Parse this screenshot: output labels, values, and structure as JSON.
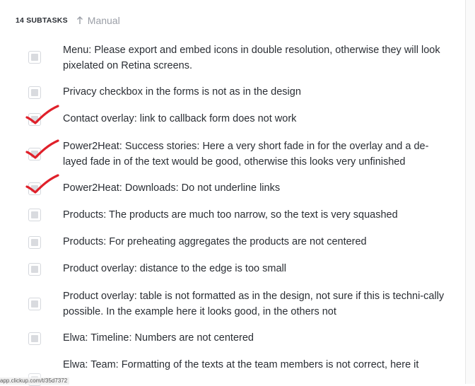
{
  "header": {
    "subtask_count": "14 SUBTASKS",
    "sort_label": "Manual",
    "sort_icon": "arrow-up-icon"
  },
  "subtasks": [
    {
      "text": "Menu: Please export and embed icons in double resolution, otherwise they will look pixelated on Retina screens.",
      "checked": false,
      "red_checkmark": false
    },
    {
      "text": "Privacy checkbox in the forms is not as in the design",
      "checked": false,
      "red_checkmark": false
    },
    {
      "text": "Contact overlay: link to callback form does not work",
      "checked": false,
      "red_checkmark": true
    },
    {
      "text": "Power2Heat: Success stories: Here a very short fade in for the overlay and a de-layed fade in of the text would be good, otherwise this looks very unfinished",
      "checked": false,
      "red_checkmark": true
    },
    {
      "text": "Power2Heat: Downloads: Do not underline links",
      "checked": false,
      "red_checkmark": true
    },
    {
      "text": "Products: The products are much too narrow, so the text is very squashed",
      "checked": false,
      "red_checkmark": false
    },
    {
      "text": "Products: For preheating aggregates the products are not centered",
      "checked": false,
      "red_checkmark": false
    },
    {
      "text": "Product overlay: distance to the edge is too small",
      "checked": false,
      "red_checkmark": false
    },
    {
      "text": "Product overlay: table is not formatted as in the design, not sure if this is techni-cally possible. In the example here it looks good, in the others not",
      "checked": false,
      "red_checkmark": false
    },
    {
      "text": "Elwa: Timeline: Numbers are not centered",
      "checked": false,
      "red_checkmark": false
    },
    {
      "text": "Elwa: Team: Formatting of the texts at the team members is not correct, here it",
      "checked": false,
      "red_checkmark": false
    }
  ],
  "status_url": "app.clickup.com/t/35d7372",
  "colors": {
    "checkmark_red": "#e0202a",
    "text": "#2a2e34",
    "muted": "#9a9ea6"
  }
}
